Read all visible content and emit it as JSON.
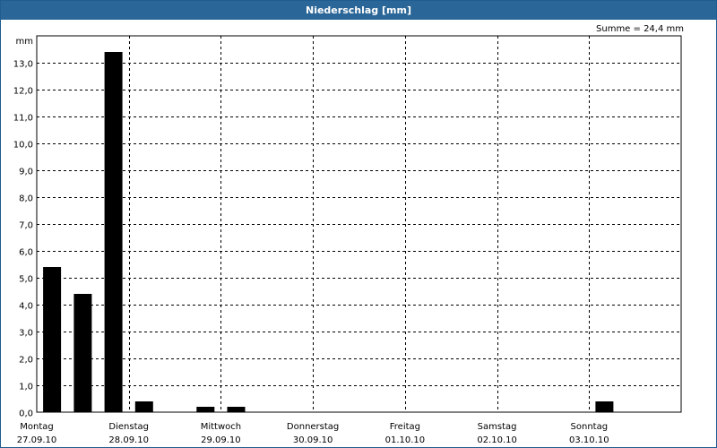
{
  "window": {
    "title": "Niederschlag [mm]"
  },
  "summary": {
    "text": "Summe = 24,4 mm"
  },
  "chart_data": {
    "type": "bar",
    "title": "Niederschlag [mm]",
    "ylabel": "mm",
    "ylim": [
      0,
      14
    ],
    "ytick_labels": [
      "0,0",
      "1,0",
      "2,0",
      "3,0",
      "4,0",
      "5,0",
      "6,0",
      "7,0",
      "8,0",
      "9,0",
      "10,0",
      "11,0",
      "12,0",
      "13,0"
    ],
    "ytick_values": [
      0,
      1,
      2,
      3,
      4,
      5,
      6,
      7,
      8,
      9,
      10,
      11,
      12,
      13
    ],
    "days": [
      {
        "weekday": "Montag",
        "date": "27.09.10"
      },
      {
        "weekday": "Dienstag",
        "date": "28.09.10"
      },
      {
        "weekday": "Mittwoch",
        "date": "29.09.10"
      },
      {
        "weekday": "Donnerstag",
        "date": "30.09.10"
      },
      {
        "weekday": "Freitag",
        "date": "01.10.10"
      },
      {
        "weekday": "Samstag",
        "date": "02.10.10"
      },
      {
        "weekday": "Sonntag",
        "date": "03.10.10"
      }
    ],
    "bars_per_day": 3,
    "values": [
      5.4,
      4.4,
      13.4,
      0.4,
      0.0,
      0.2,
      0.2,
      0,
      0,
      0,
      0,
      0,
      0,
      0,
      0,
      0,
      0,
      0,
      0.4,
      0,
      0
    ],
    "bar_color": "#000000",
    "grid": true,
    "grid_style": "dashed",
    "total": "Summe = 24,4 mm"
  }
}
